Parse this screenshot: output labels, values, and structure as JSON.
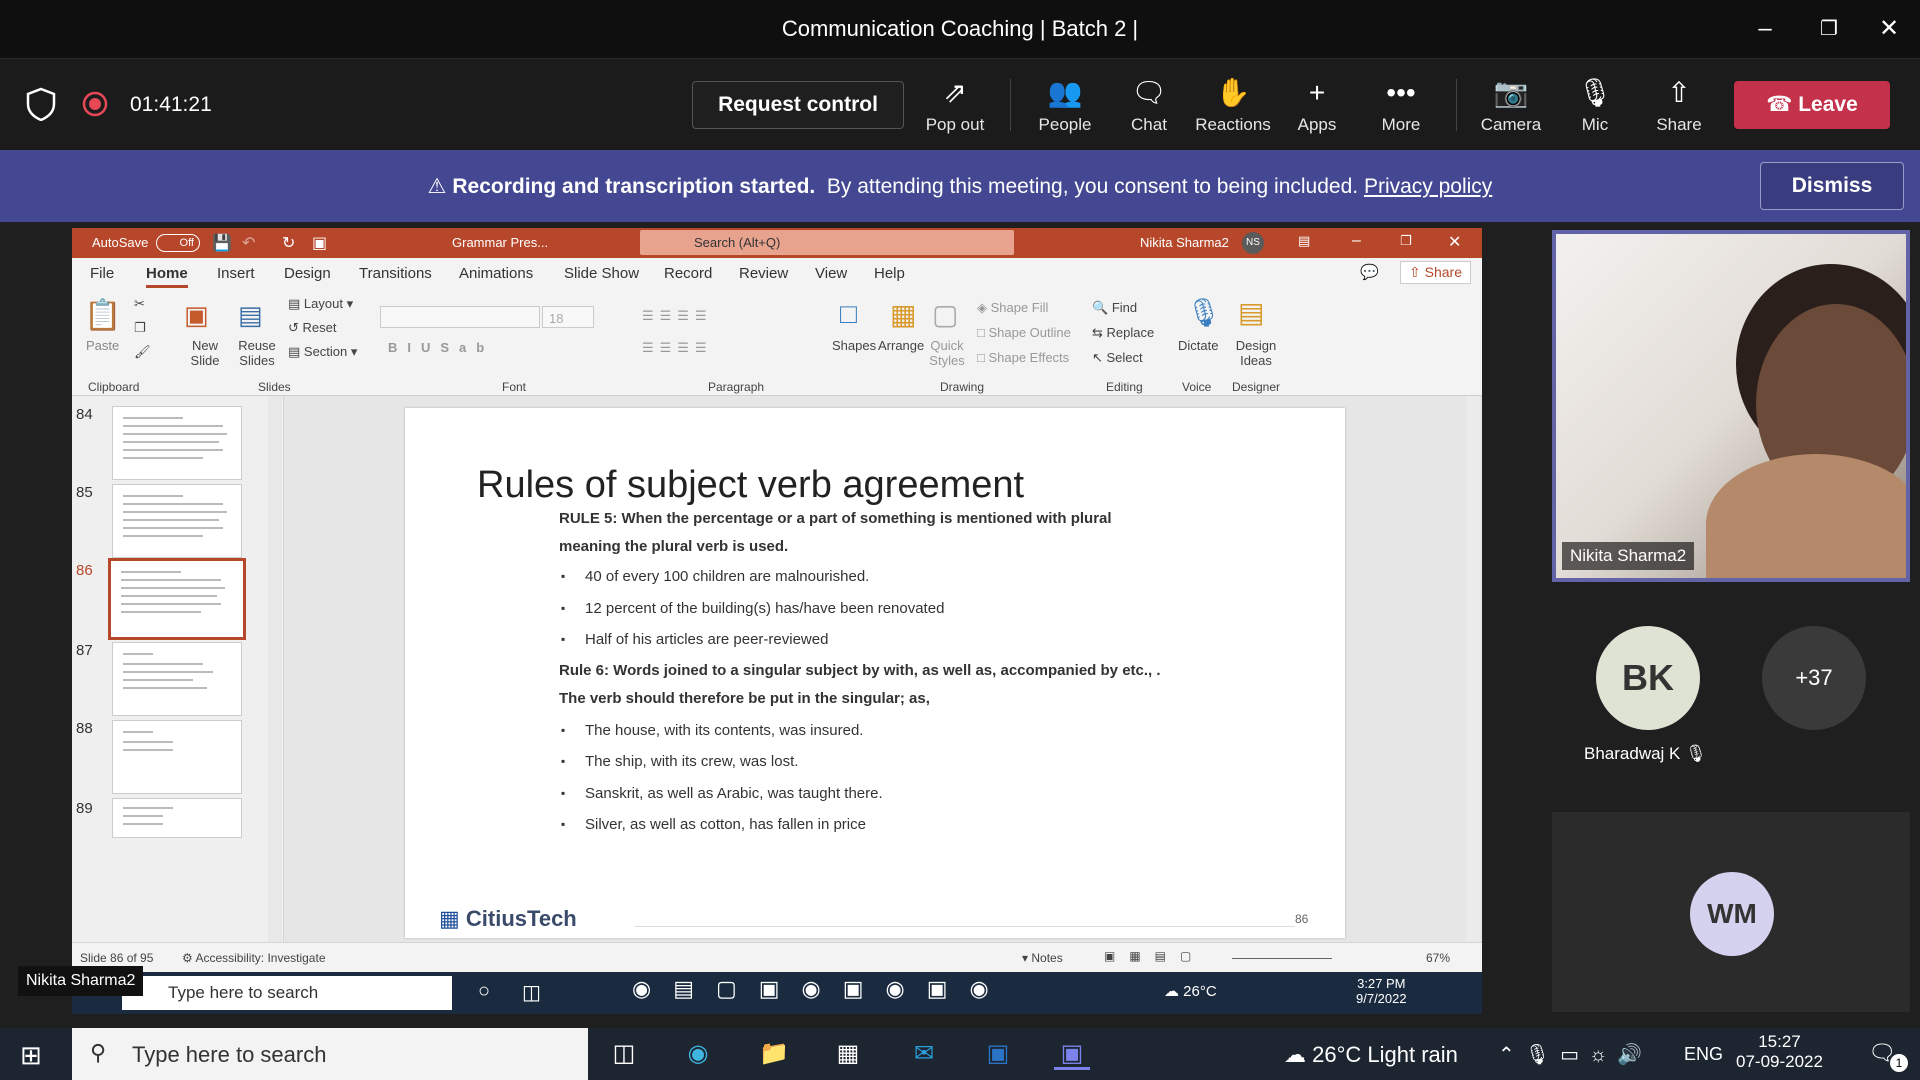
{
  "window": {
    "title": "Communication Coaching | Batch 2 |"
  },
  "meeting_bar": {
    "timer": "01:41:21",
    "request_control": "Request control",
    "buttons": [
      {
        "label": "Pop out",
        "icon": "pop-out-icon"
      },
      {
        "label": "People",
        "icon": "people-icon"
      },
      {
        "label": "Chat",
        "icon": "chat-icon"
      },
      {
        "label": "Reactions",
        "icon": "reactions-icon"
      },
      {
        "label": "Apps",
        "icon": "plus-icon"
      },
      {
        "label": "More",
        "icon": "more-icon"
      },
      {
        "label": "Camera",
        "icon": "camera-off-icon"
      },
      {
        "label": "Mic",
        "icon": "mic-off-icon"
      },
      {
        "label": "Share",
        "icon": "share-icon"
      }
    ],
    "leave": "Leave",
    "colors": {
      "leave": "#c4314b",
      "banner": "#444791",
      "accent": "#6264a7"
    }
  },
  "banner": {
    "bold": "Recording and transcription started.",
    "text": "By attending this meeting, you consent to being included.",
    "link": "Privacy policy",
    "dismiss": "Dismiss"
  },
  "ppt": {
    "autosave": "AutoSave",
    "autosave_state": "Off",
    "filename": "Grammar Pres...",
    "search_placeholder": "Search (Alt+Q)",
    "user": "Nikita Sharma2",
    "user_initials": "NS",
    "share": "Share",
    "menu": [
      "File",
      "Home",
      "Insert",
      "Design",
      "Transitions",
      "Animations",
      "Slide Show",
      "Record",
      "Review",
      "View",
      "Help"
    ],
    "active_menu": "Home",
    "ribbon": {
      "paste": "Paste",
      "new_slide": "New Slide",
      "reuse_slides": "Reuse Slides",
      "layout": "Layout",
      "reset": "Reset",
      "section": "Section",
      "font_size": "18",
      "shapes": "Shapes",
      "arrange": "Arrange",
      "quick_styles": "Quick Styles",
      "shape_fill": "Shape Fill",
      "shape_outline": "Shape Outline",
      "shape_effects": "Shape Effects",
      "find": "Find",
      "replace": "Replace",
      "select": "Select",
      "dictate": "Dictate",
      "design_ideas": "Design Ideas",
      "groups": [
        "Clipboard",
        "Slides",
        "Font",
        "Paragraph",
        "Drawing",
        "Editing",
        "Voice",
        "Designer"
      ]
    },
    "thumbnails": [
      {
        "num": "84",
        "title": "Rules of subject verb agreement"
      },
      {
        "num": "85",
        "title": "Rules of subject verb agreement"
      },
      {
        "num": "86",
        "title": "Rules of subject verb agreement"
      },
      {
        "num": "87",
        "title": "Activity"
      },
      {
        "num": "88",
        "title": "Role Play"
      },
      {
        "num": "89",
        "title": "Commonly used words"
      }
    ],
    "selected_slide": "86",
    "slide": {
      "title": "Rules of subject verb agreement",
      "rule5_line1": "RULE 5: When the percentage or a part of something is mentioned with plural",
      "rule5_line2": "meaning the plural verb is used.",
      "rule5_bullets": [
        "40 of every 100 children are malnourished.",
        "12 percent of the building(s) has/have been renovated",
        "Half of his articles are peer-reviewed"
      ],
      "rule6_line1": "Rule 6: Words joined to a singular subject by with, as well as, accompanied by etc., .",
      "rule6_line2": "The verb should therefore be put in the singular; as,",
      "rule6_bullets": [
        "The house, with its contents, was insured.",
        "The ship, with its crew, was lost.",
        "Sanskrit, as well as Arabic, was taught there.",
        "Silver, as well as cotton, has fallen in price"
      ],
      "logo": "CitiusTech",
      "page_number": "86"
    },
    "status": {
      "slide_of": "Slide 86 of 95",
      "accessibility": "Accessibility: Investigate",
      "notes": "Notes",
      "zoom": "67%"
    }
  },
  "inner_taskbar": {
    "search": "Type here to search",
    "weather": "26°C",
    "time": "3:27 PM",
    "date": "9/7/2022",
    "presenter_tag": "Nikita Sharma2"
  },
  "participants": {
    "video_name": "Nikita Sharma2",
    "bk_initials": "BK",
    "bk_name": "Bharadwaj K",
    "more_count": "+37",
    "wm_initials": "WM"
  },
  "taskbar": {
    "search": "Type here to search",
    "weather": "26°C  Light rain",
    "lang": "ENG",
    "time": "15:27",
    "date": "07-09-2022",
    "notif_count": "1"
  }
}
